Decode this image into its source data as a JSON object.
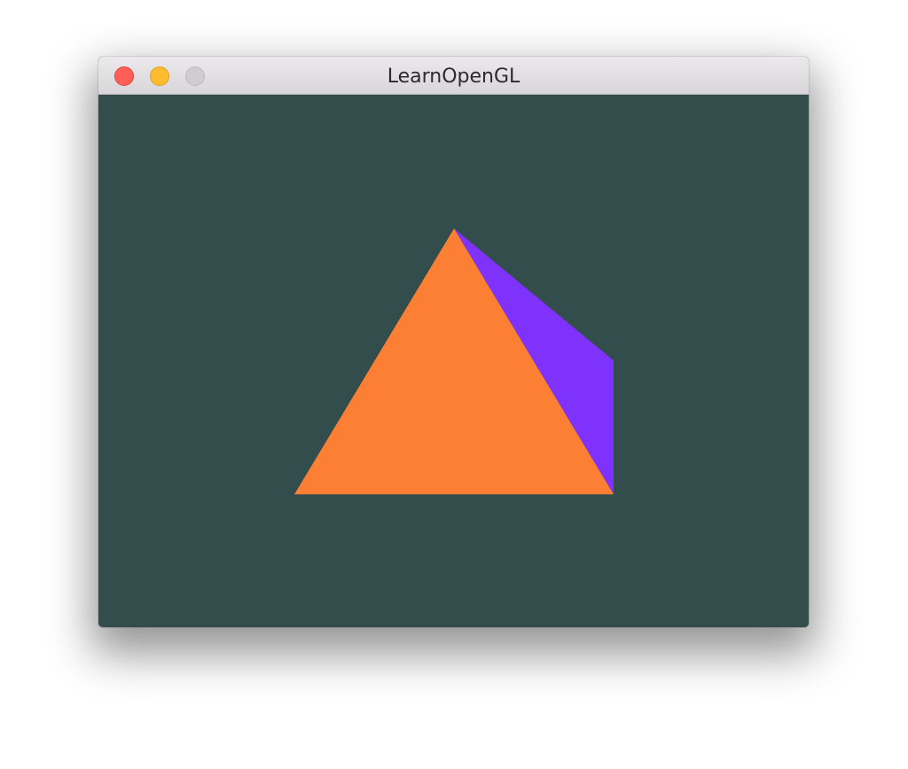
{
  "window": {
    "title": "LearnOpenGL"
  },
  "colors": {
    "close_button": "#ff5f57",
    "minimize_button": "#febc2e",
    "zoom_button": "#cfcdcf",
    "clear_color": "#334d4d",
    "front_face": "#fd7f33",
    "side_face": "#8032fd"
  }
}
